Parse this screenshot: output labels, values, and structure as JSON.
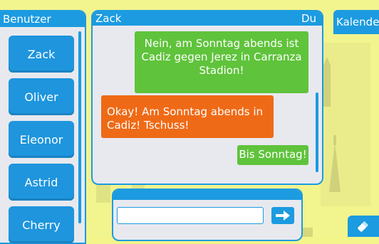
{
  "users": {
    "title": "Benutzer",
    "items": [
      {
        "label": "Zack"
      },
      {
        "label": "Oliver"
      },
      {
        "label": "Eleonor"
      },
      {
        "label": "Astrid"
      },
      {
        "label": "Cherry"
      }
    ]
  },
  "chat": {
    "contact": "Zack",
    "self": "Du",
    "messages": [
      {
        "from": "self",
        "text": "Nein, am Sonntag abends ist Cadiz gegen Jerez in Carranza Stadion!"
      },
      {
        "from": "contact",
        "text": "Okay! Am Sonntag abends in Cadiz! Tschuss!"
      },
      {
        "from": "self",
        "text": "Bis Sonntag!"
      }
    ]
  },
  "composer": {
    "placeholder": "",
    "send_icon": "send-arrow-icon"
  },
  "sidebar_right": {
    "calendar_label": "Kalender",
    "tool_icon": "pencil-eraser-icon"
  },
  "colors": {
    "accent": "#1c9be0",
    "self_bubble": "#5fc33b",
    "contact_bubble": "#ef6a16",
    "background": "#f2f48e"
  }
}
